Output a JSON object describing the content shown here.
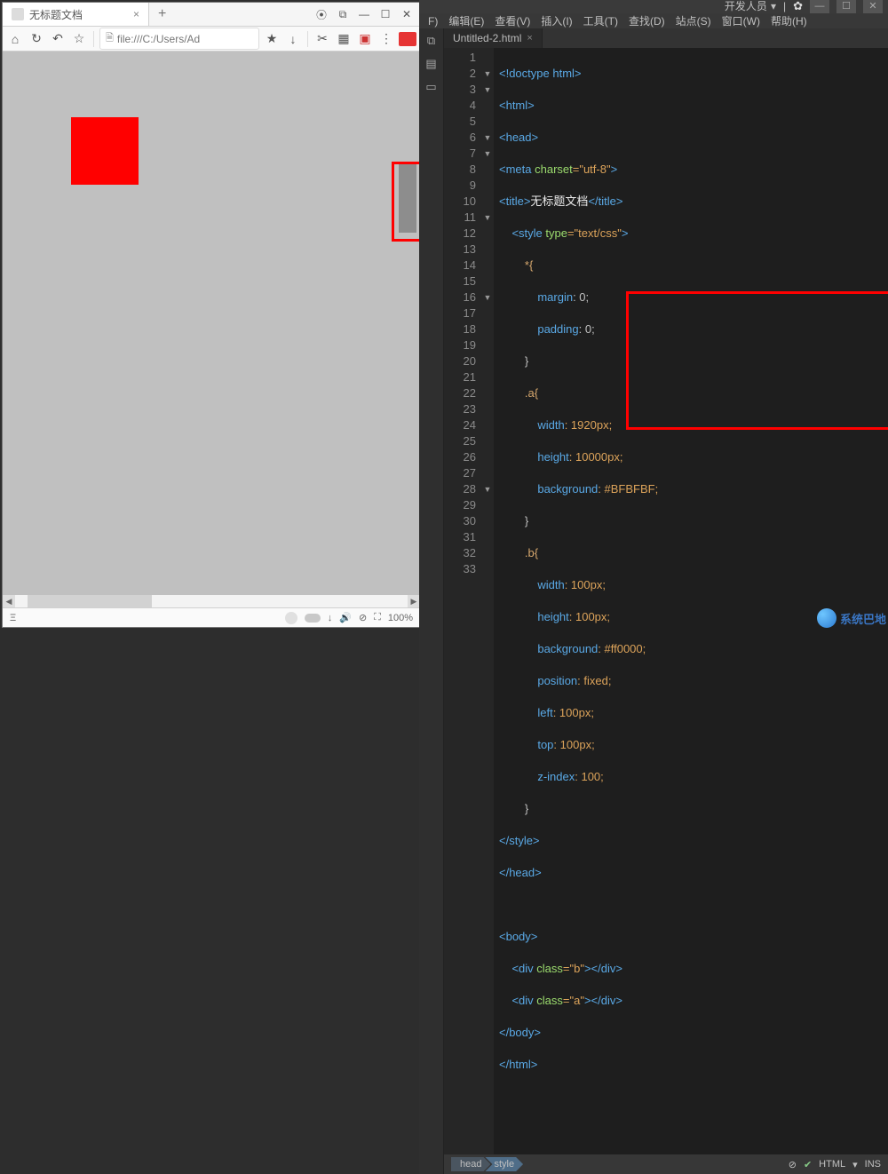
{
  "browser": {
    "tab_title": "无标题文档",
    "url_text": "file:///C:/Users/Ad",
    "zoom": "100%"
  },
  "ide": {
    "titlebar_dropdown": "开发人员",
    "menus": [
      "F)",
      "编辑(E)",
      "查看(V)",
      "插入(I)",
      "工具(T)",
      "查找(D)",
      "站点(S)",
      "窗口(W)",
      "帮助(H)"
    ],
    "file_tab": "Untitled-2.html",
    "breadcrumb": [
      "head",
      "style"
    ],
    "status_lang": "HTML",
    "status_ins": "INS"
  },
  "code": {
    "l1": "<!doctype html>",
    "l2": "<html>",
    "l3": "<head>",
    "l4a": "<meta ",
    "l4b": "charset",
    "l4c": "=\"utf-8\"",
    "l4d": ">",
    "l5a": "<title>",
    "l5b": "无标题文档",
    "l5c": "</title>",
    "l6a": "    <style ",
    "l6b": "type",
    "l6c": "=\"text/css\"",
    "l6d": ">",
    "l7": "        *{",
    "l8a": "            margin",
    "l8b": ": 0;",
    "l9a": "            padding",
    "l9b": ": 0;",
    "l10": "        }",
    "l11": "        .a{",
    "l12a": "            width",
    "l12b": ": 1920px;",
    "l13a": "            height",
    "l13b": ": 10000px;",
    "l14a": "            background",
    "l14b": ": #BFBFBF;",
    "l15": "        }",
    "l16": "        .b{",
    "l17a": "            width",
    "l17b": ": 100px;",
    "l18a": "            height",
    "l18b": ": 100px;",
    "l19a": "            background",
    "l19b": ": #ff0000;",
    "l20a": "            position",
    "l20b": ": fixed;",
    "l21a": "            left",
    "l21b": ": 100px;",
    "l22a": "            top",
    "l22b": ": 100px;",
    "l23a": "            z-index",
    "l23b": ": 100;",
    "l24": "        }",
    "l25": "</style>",
    "l26": "</head>",
    "l27": "",
    "l28": "<body>",
    "l29a": "    <div ",
    "l29b": "class",
    "l29c": "=\"b\"",
    "l29d": "></div>",
    "l30a": "    <div ",
    "l30b": "class",
    "l30c": "=\"a\"",
    "l30d": "></div>",
    "l31": "</body>",
    "l32": "</html>"
  },
  "watermark": "系统巴地"
}
